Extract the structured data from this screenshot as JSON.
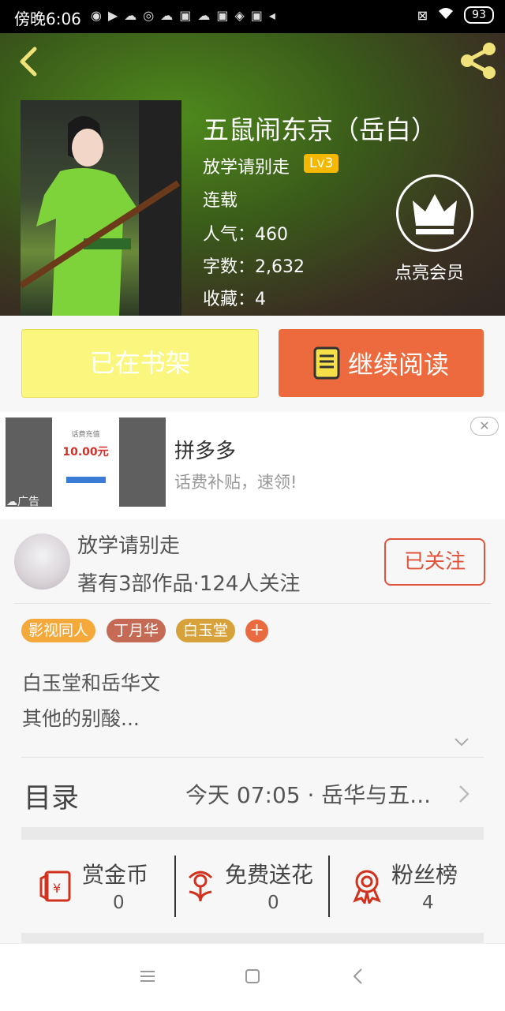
{
  "status_bar": {
    "time": "傍晚6:06",
    "battery": "93"
  },
  "book": {
    "title": "五鼠闹东京（岳白）",
    "author": "放学请别走",
    "level": "Lv3",
    "status": "连载",
    "popularity": "人气：460",
    "word_count": "字数：2,632",
    "favorites": "收藏：4"
  },
  "vip": {
    "label": "点亮会员"
  },
  "actions": {
    "shelf_label": "已在书架",
    "read_label": "继续阅读"
  },
  "ad": {
    "title": "拼多多",
    "subtitle": "话费补贴，速领!",
    "mark": "广告",
    "price": "10.00元",
    "phone_header": "话费充值"
  },
  "author_card": {
    "name": "放学请别走",
    "info": "著有3部作品·124人关注",
    "follow_label": "已关注"
  },
  "tags": [
    {
      "label": "影视同人",
      "color": "#f4a93a"
    },
    {
      "label": "丁月华",
      "color": "#c56a55"
    },
    {
      "label": "白玉堂",
      "color": "#d7a23b"
    }
  ],
  "add_tag": "+",
  "description": {
    "line1": "白玉堂和岳华文",
    "line2": "其他的别酸..."
  },
  "toc": {
    "label": "目录",
    "latest": "今天 07:05 · 岳华与五..."
  },
  "stats": [
    {
      "label": "赏金币",
      "value": "0",
      "icon": "reward-coin-icon"
    },
    {
      "label": "免费送花",
      "value": "0",
      "icon": "flower-icon"
    },
    {
      "label": "粉丝榜",
      "value": "4",
      "icon": "medal-icon"
    }
  ],
  "colors": {
    "accent": "#ec6a3d",
    "follow": "#e0533b",
    "shelf": "#fbf77e",
    "level": "#f5b800"
  }
}
